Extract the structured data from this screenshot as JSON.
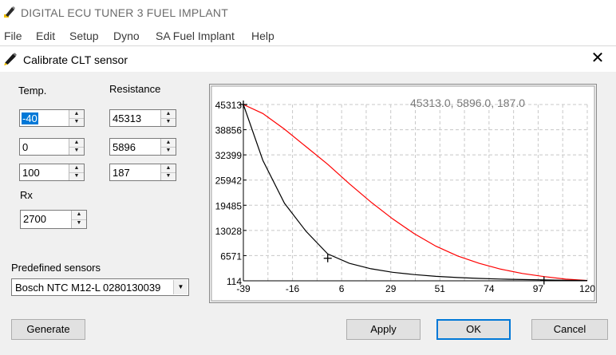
{
  "app": {
    "title": "DIGITAL ECU TUNER 3 FUEL IMPLANT",
    "icon": "pencil-icon"
  },
  "menu": [
    "File",
    "Edit",
    "Setup",
    "Dyno",
    "SA Fuel Implant",
    "Help"
  ],
  "dialog": {
    "title": "Calibrate CLT sensor",
    "icon": "pencil-icon",
    "close_glyph": "✕"
  },
  "form": {
    "temp_label": "Temp.",
    "resistance_label": "Resistance",
    "temps": [
      "-40",
      "0",
      "100"
    ],
    "resistances": [
      "45313",
      "5896",
      "187"
    ],
    "rx_label": "Rx",
    "rx_value": "2700",
    "predefined_label": "Predefined sensors",
    "predefined_value": "Bosch NTC M12-L 0280130039"
  },
  "buttons": {
    "generate": "Generate",
    "apply": "Apply",
    "ok": "OK",
    "cancel": "Cancel"
  },
  "chart_data": {
    "type": "line",
    "readout": "45313.0,  5896.0,  187.0",
    "xlim": [
      -39,
      120
    ],
    "ylim": [
      114,
      45313
    ],
    "x_ticks": [
      "-39",
      "-16",
      "6",
      "29",
      "51",
      "74",
      "97",
      "120"
    ],
    "y_ticks": [
      "45313",
      "38856",
      "32399",
      "25942",
      "19485",
      "13028",
      "6571",
      "114"
    ],
    "grid": true,
    "colors": {
      "calibrated": "#000000",
      "reference": "#ff0000",
      "grid": "#c8c8c8"
    },
    "series": [
      {
        "color": "#000000",
        "x": [
          -39,
          -30,
          -20,
          -10,
          0,
          10,
          20,
          30,
          40,
          50,
          60,
          70,
          80,
          90,
          100,
          110,
          120
        ],
        "y": [
          45313,
          31000,
          20000,
          12800,
          7000,
          4600,
          3200,
          2300,
          1700,
          1250,
          950,
          730,
          570,
          450,
          360,
          250,
          187
        ]
      },
      {
        "color": "#ff0000",
        "x": [
          -39,
          -30,
          -20,
          -10,
          0,
          10,
          20,
          30,
          40,
          50,
          60,
          70,
          80,
          90,
          100,
          110,
          120
        ],
        "y": [
          45313,
          43000,
          39000,
          34500,
          30000,
          25000,
          20300,
          16000,
          12200,
          9000,
          6500,
          4600,
          3100,
          2000,
          1200,
          550,
          187
        ]
      }
    ],
    "markers": [
      {
        "x": -39,
        "y": 45313
      },
      {
        "x": 0,
        "y": 5896
      },
      {
        "x": 100,
        "y": 187
      }
    ]
  }
}
